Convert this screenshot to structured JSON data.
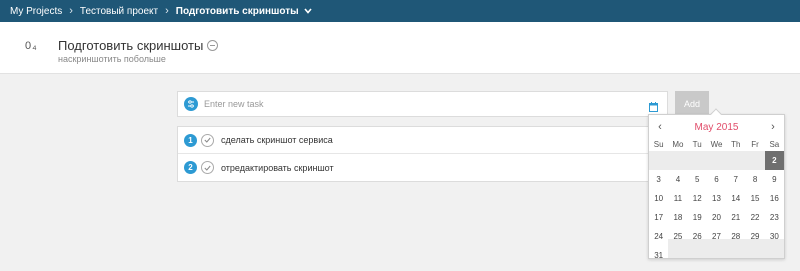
{
  "breadcrumb": {
    "items": [
      "My Projects",
      "Тестовый проект",
      "Подготовить скриншоты"
    ],
    "separator": "›"
  },
  "header": {
    "count": "0₄",
    "title": "Подготовить скриншоты",
    "subtitle": "наскриншотить побольше"
  },
  "task_input": {
    "placeholder": "Enter new task",
    "add_label": "Add"
  },
  "tasks": [
    {
      "number": "1",
      "label": "сделать скриншот сервиса"
    },
    {
      "number": "2",
      "label": "отредактировать скриншот"
    }
  ],
  "calendar": {
    "month": "May 2015",
    "prev": "‹",
    "next": "›",
    "weekdays": [
      "Su",
      "Mo",
      "Tu",
      "We",
      "Th",
      "Fr",
      "Sa"
    ],
    "selected_day": "2",
    "days": [
      "",
      "",
      "",
      "",
      "",
      "",
      "2",
      "3",
      "4",
      "5",
      "6",
      "7",
      "8",
      "9",
      "10",
      "11",
      "12",
      "13",
      "14",
      "15",
      "16",
      "17",
      "18",
      "19",
      "20",
      "21",
      "22",
      "23",
      "24",
      "25",
      "26",
      "27",
      "28",
      "29",
      "30",
      "31"
    ]
  },
  "colors": {
    "topbar": "#1f5777",
    "accent": "#2d9ad3",
    "month_label": "#e14d6a"
  },
  "icons": {
    "options": "sliders-icon",
    "calendar": "calendar-icon",
    "check": "check-icon",
    "dropdown": "chevron-down-icon"
  }
}
